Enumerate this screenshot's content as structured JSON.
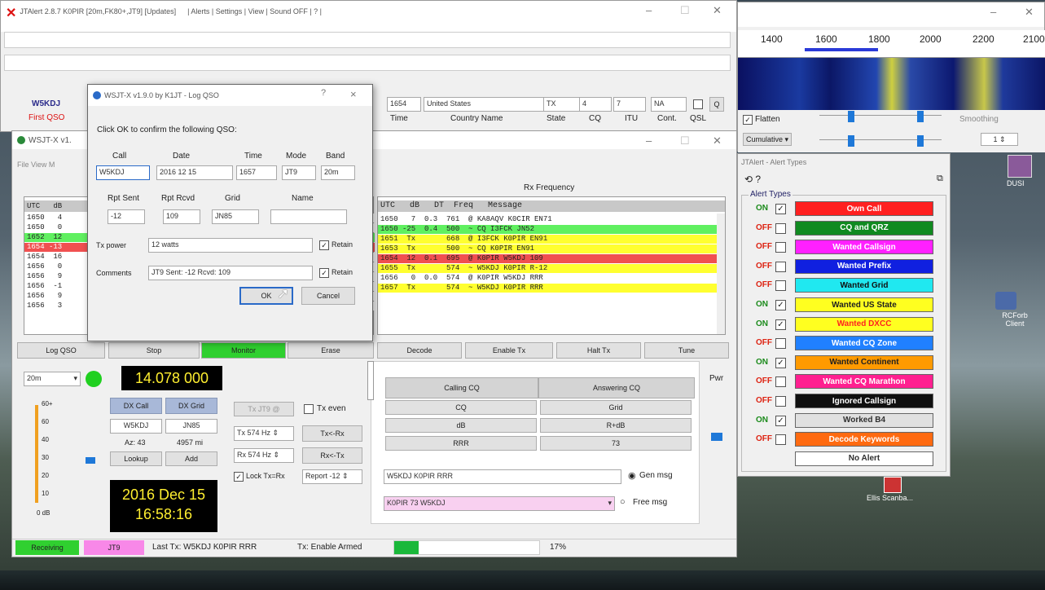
{
  "jtalert": {
    "title": "JTAlert 2.8.7 K0PIR [20m,FK80+,JT9] [Updates]",
    "menu": "| Alerts | Settings | View | Sound OFF | ? |",
    "callsign": "W5KDJ",
    "first_qso": "First QSO",
    "grid_num": "1654",
    "country": "United States",
    "state": "TX",
    "cq": "4",
    "itu": "7",
    "cont": "NA",
    "q_label": "Q",
    "col_time": "Time",
    "col_country": "Country Name",
    "col_state": "State",
    "col_cq": "CQ",
    "col_itu": "ITU",
    "col_cont": "Cont.",
    "col_qsl": "QSL"
  },
  "wsjt": {
    "title": "WSJT-X   v1.",
    "menu": "File  View  M",
    "rx_freq_label": "Rx Frequency",
    "left_header": "UTC   dB",
    "left_rows": [
      "1650   4",
      "1650   0",
      "1652  12",
      "1654 -13",
      "1654  16",
      "1656   0",
      "1656   9",
      "1656  -1",
      "1656   9",
      "1656   3"
    ],
    "right_header": "UTC   dB   DT  Freq   Message",
    "right_rows": [
      "1650   7  0.3  761  @ KA8AQV K0CIR EN71",
      "1650 -25  0.4  500  ~ CQ I3FCK JN52",
      "1651  Tx       668  @ I3FCK K0PIR EN91",
      "1653  Tx       500  ~ CQ K0PIR EN91",
      "1654  12  0.1  695  @ K0PIR W5KDJ 109",
      "1655  Tx       574  ~ W5KDJ K0PIR R-12",
      "1656   0  0.0  574  @ K0PIR W5KDJ RRR",
      "1657  Tx       574  ~ W5KDJ K0PIR RRR"
    ],
    "buttons": [
      "Log QSO",
      "Stop",
      "Monitor",
      "Erase",
      "Decode",
      "Enable Tx",
      "Halt Tx",
      "Tune"
    ],
    "band": "20m",
    "frequency": "14.078 000",
    "dx_call_label": "DX Call",
    "dx_grid_label": "DX Grid",
    "dx_call": "W5KDJ",
    "dx_grid": "JN85",
    "az": "Az: 43",
    "dist": "4957 mi",
    "lookup": "Lookup",
    "add": "Add",
    "tx_jt9": "Tx JT9 @",
    "tx_even": "Tx even",
    "tx_hz": "Tx 574 Hz",
    "tx_rx": "Tx<-Rx",
    "rx_hz": "Rx 574 Hz",
    "rx_tx": "Rx<-Tx",
    "lock": "Lock Tx=Rx",
    "report": "Report -12",
    "date": "2016 Dec 15",
    "time": "16:58:16",
    "db_labels": [
      "60+",
      "60",
      "40",
      "30",
      "20",
      "10"
    ],
    "db_unit": "0 dB",
    "pwr": "Pwr",
    "tab_calling": "Calling CQ",
    "tab_answering": "Answering CQ",
    "msg_rows": [
      [
        "CQ",
        "Grid"
      ],
      [
        "dB",
        "R+dB"
      ],
      [
        "RRR",
        "73"
      ]
    ],
    "gen_msg_value": "W5KDJ K0PIR RRR",
    "gen_msg": "Gen msg",
    "free_msg_value": "K0PIR 73 W5KDJ",
    "free_msg": "Free msg",
    "status_receiving": "Receiving",
    "status_mode": "JT9",
    "status_last_tx": "Last Tx: W5KDJ K0PIR RRR",
    "status_armed": "Tx: Enable Armed",
    "status_pct": "17%"
  },
  "dialog": {
    "title": "WSJT-X  v1.9.0  by K1JT - Log QSO",
    "help": "?",
    "close": "×",
    "prompt": "Click OK to confirm the following QSO:",
    "labels": {
      "call": "Call",
      "date": "Date",
      "time": "Time",
      "mode": "Mode",
      "band": "Band",
      "rpt_sent": "Rpt Sent",
      "rpt_rcvd": "Rpt Rcvd",
      "grid": "Grid",
      "name": "Name",
      "tx_power": "Tx power",
      "comments": "Comments",
      "retain1": "Retain",
      "retain2": "Retain"
    },
    "values": {
      "call": "W5KDJ",
      "date": "2016 12 15",
      "time": "1657",
      "mode": "JT9",
      "band": "20m",
      "rpt_sent": "-12",
      "rpt_rcvd": "109",
      "grid": "JN85",
      "name": "",
      "tx_power": "12 watts",
      "comments": "JT9 Sent: -12 Rcvd: 109"
    },
    "ok": "OK",
    "cancel": "Cancel"
  },
  "wide": {
    "freqs": [
      "1400",
      "1600",
      "1800",
      "2000",
      "2200",
      "2100"
    ],
    "flatten": "Flatten",
    "smoothing": "Smoothing",
    "cumulative": "Cumulative",
    "spin": "1"
  },
  "alerts": {
    "title": "JTAlert - Alert Types",
    "group": "Alert Types",
    "items": [
      {
        "state": "ON",
        "checked": true,
        "label": "Own Call",
        "bg": "#ff2020",
        "fg": "#ffffff"
      },
      {
        "state": "OFF",
        "checked": false,
        "label": "CQ and QRZ",
        "bg": "#108a20",
        "fg": "#ffffff"
      },
      {
        "state": "OFF",
        "checked": false,
        "label": "Wanted Callsign",
        "bg": "#ff20ff",
        "fg": "#ffffff"
      },
      {
        "state": "OFF",
        "checked": false,
        "label": "Wanted Prefix",
        "bg": "#1020e0",
        "fg": "#ffffff"
      },
      {
        "state": "OFF",
        "checked": false,
        "label": "Wanted Grid",
        "bg": "#20e8f0",
        "fg": "#101010"
      },
      {
        "state": "ON",
        "checked": true,
        "label": "Wanted US State",
        "bg": "#ffff20",
        "fg": "#202020"
      },
      {
        "state": "ON",
        "checked": true,
        "label": "Wanted DXCC",
        "bg": "#ffff20",
        "fg": "#ff2020"
      },
      {
        "state": "OFF",
        "checked": false,
        "label": "Wanted CQ Zone",
        "bg": "#2080ff",
        "fg": "#ffffff"
      },
      {
        "state": "ON",
        "checked": true,
        "label": "Wanted Continent",
        "bg": "#ff9a00",
        "fg": "#202020"
      },
      {
        "state": "OFF",
        "checked": false,
        "label": "Wanted CQ Marathon",
        "bg": "#ff2090",
        "fg": "#ffffff"
      },
      {
        "state": "OFF",
        "checked": false,
        "label": "Ignored Callsign",
        "bg": "#101010",
        "fg": "#ffffff"
      },
      {
        "state": "ON",
        "checked": true,
        "label": "Worked B4",
        "bg": "#e0e0e0",
        "fg": "#303030"
      },
      {
        "state": "OFF",
        "checked": false,
        "label": "Decode Keywords",
        "bg": "#ff6a10",
        "fg": "#ffffff"
      },
      {
        "state": "",
        "checked": false,
        "label": "No Alert",
        "bg": "#ffffff",
        "fg": "#303030"
      }
    ]
  },
  "desktop": {
    "icon1": "DUSI",
    "icon2": "RCForb Client",
    "icon3": "Ellis Scanba..."
  }
}
